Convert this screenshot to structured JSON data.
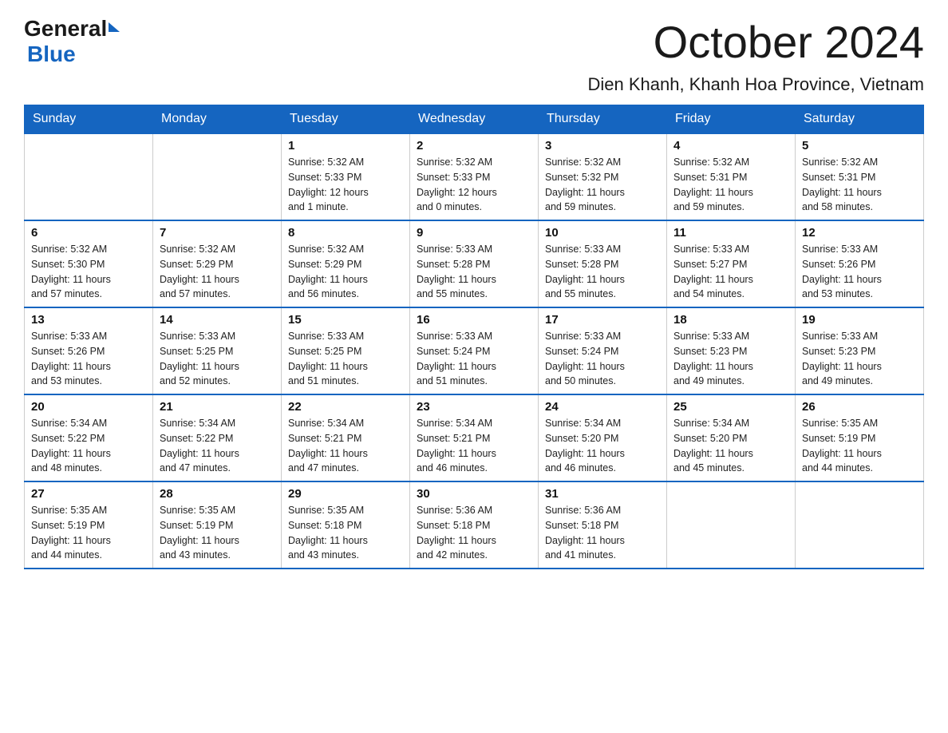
{
  "logo": {
    "general": "General",
    "blue": "Blue",
    "triangle": "▶"
  },
  "header": {
    "month_year": "October 2024",
    "location": "Dien Khanh, Khanh Hoa Province, Vietnam"
  },
  "days_of_week": [
    "Sunday",
    "Monday",
    "Tuesday",
    "Wednesday",
    "Thursday",
    "Friday",
    "Saturday"
  ],
  "weeks": [
    [
      {
        "day": "",
        "info": ""
      },
      {
        "day": "",
        "info": ""
      },
      {
        "day": "1",
        "info": "Sunrise: 5:32 AM\nSunset: 5:33 PM\nDaylight: 12 hours\nand 1 minute."
      },
      {
        "day": "2",
        "info": "Sunrise: 5:32 AM\nSunset: 5:33 PM\nDaylight: 12 hours\nand 0 minutes."
      },
      {
        "day": "3",
        "info": "Sunrise: 5:32 AM\nSunset: 5:32 PM\nDaylight: 11 hours\nand 59 minutes."
      },
      {
        "day": "4",
        "info": "Sunrise: 5:32 AM\nSunset: 5:31 PM\nDaylight: 11 hours\nand 59 minutes."
      },
      {
        "day": "5",
        "info": "Sunrise: 5:32 AM\nSunset: 5:31 PM\nDaylight: 11 hours\nand 58 minutes."
      }
    ],
    [
      {
        "day": "6",
        "info": "Sunrise: 5:32 AM\nSunset: 5:30 PM\nDaylight: 11 hours\nand 57 minutes."
      },
      {
        "day": "7",
        "info": "Sunrise: 5:32 AM\nSunset: 5:29 PM\nDaylight: 11 hours\nand 57 minutes."
      },
      {
        "day": "8",
        "info": "Sunrise: 5:32 AM\nSunset: 5:29 PM\nDaylight: 11 hours\nand 56 minutes."
      },
      {
        "day": "9",
        "info": "Sunrise: 5:33 AM\nSunset: 5:28 PM\nDaylight: 11 hours\nand 55 minutes."
      },
      {
        "day": "10",
        "info": "Sunrise: 5:33 AM\nSunset: 5:28 PM\nDaylight: 11 hours\nand 55 minutes."
      },
      {
        "day": "11",
        "info": "Sunrise: 5:33 AM\nSunset: 5:27 PM\nDaylight: 11 hours\nand 54 minutes."
      },
      {
        "day": "12",
        "info": "Sunrise: 5:33 AM\nSunset: 5:26 PM\nDaylight: 11 hours\nand 53 minutes."
      }
    ],
    [
      {
        "day": "13",
        "info": "Sunrise: 5:33 AM\nSunset: 5:26 PM\nDaylight: 11 hours\nand 53 minutes."
      },
      {
        "day": "14",
        "info": "Sunrise: 5:33 AM\nSunset: 5:25 PM\nDaylight: 11 hours\nand 52 minutes."
      },
      {
        "day": "15",
        "info": "Sunrise: 5:33 AM\nSunset: 5:25 PM\nDaylight: 11 hours\nand 51 minutes."
      },
      {
        "day": "16",
        "info": "Sunrise: 5:33 AM\nSunset: 5:24 PM\nDaylight: 11 hours\nand 51 minutes."
      },
      {
        "day": "17",
        "info": "Sunrise: 5:33 AM\nSunset: 5:24 PM\nDaylight: 11 hours\nand 50 minutes."
      },
      {
        "day": "18",
        "info": "Sunrise: 5:33 AM\nSunset: 5:23 PM\nDaylight: 11 hours\nand 49 minutes."
      },
      {
        "day": "19",
        "info": "Sunrise: 5:33 AM\nSunset: 5:23 PM\nDaylight: 11 hours\nand 49 minutes."
      }
    ],
    [
      {
        "day": "20",
        "info": "Sunrise: 5:34 AM\nSunset: 5:22 PM\nDaylight: 11 hours\nand 48 minutes."
      },
      {
        "day": "21",
        "info": "Sunrise: 5:34 AM\nSunset: 5:22 PM\nDaylight: 11 hours\nand 47 minutes."
      },
      {
        "day": "22",
        "info": "Sunrise: 5:34 AM\nSunset: 5:21 PM\nDaylight: 11 hours\nand 47 minutes."
      },
      {
        "day": "23",
        "info": "Sunrise: 5:34 AM\nSunset: 5:21 PM\nDaylight: 11 hours\nand 46 minutes."
      },
      {
        "day": "24",
        "info": "Sunrise: 5:34 AM\nSunset: 5:20 PM\nDaylight: 11 hours\nand 46 minutes."
      },
      {
        "day": "25",
        "info": "Sunrise: 5:34 AM\nSunset: 5:20 PM\nDaylight: 11 hours\nand 45 minutes."
      },
      {
        "day": "26",
        "info": "Sunrise: 5:35 AM\nSunset: 5:19 PM\nDaylight: 11 hours\nand 44 minutes."
      }
    ],
    [
      {
        "day": "27",
        "info": "Sunrise: 5:35 AM\nSunset: 5:19 PM\nDaylight: 11 hours\nand 44 minutes."
      },
      {
        "day": "28",
        "info": "Sunrise: 5:35 AM\nSunset: 5:19 PM\nDaylight: 11 hours\nand 43 minutes."
      },
      {
        "day": "29",
        "info": "Sunrise: 5:35 AM\nSunset: 5:18 PM\nDaylight: 11 hours\nand 43 minutes."
      },
      {
        "day": "30",
        "info": "Sunrise: 5:36 AM\nSunset: 5:18 PM\nDaylight: 11 hours\nand 42 minutes."
      },
      {
        "day": "31",
        "info": "Sunrise: 5:36 AM\nSunset: 5:18 PM\nDaylight: 11 hours\nand 41 minutes."
      },
      {
        "day": "",
        "info": ""
      },
      {
        "day": "",
        "info": ""
      }
    ]
  ]
}
